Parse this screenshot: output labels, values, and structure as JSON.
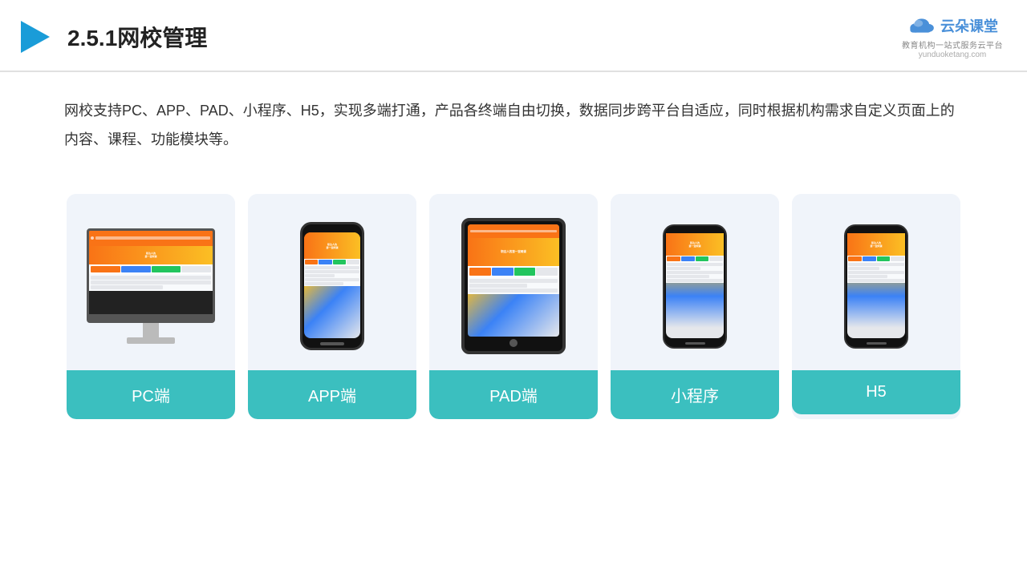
{
  "header": {
    "title": "2.5.1网校管理",
    "logo_name": "云朵课堂",
    "logo_url": "yunduoketang.com",
    "logo_tagline": "教育机构一站\n式服务云平台"
  },
  "description": {
    "text": "网校支持PC、APP、PAD、小程序、H5，实现多端打通，产品各终端自由切换，数据同步跨平台自适应，同时根据机构需求自定义页面上的内容、课程、功能模块等。"
  },
  "cards": [
    {
      "id": "pc",
      "label": "PC端"
    },
    {
      "id": "app",
      "label": "APP端"
    },
    {
      "id": "pad",
      "label": "PAD端"
    },
    {
      "id": "mini",
      "label": "小程序"
    },
    {
      "id": "h5",
      "label": "H5"
    }
  ]
}
